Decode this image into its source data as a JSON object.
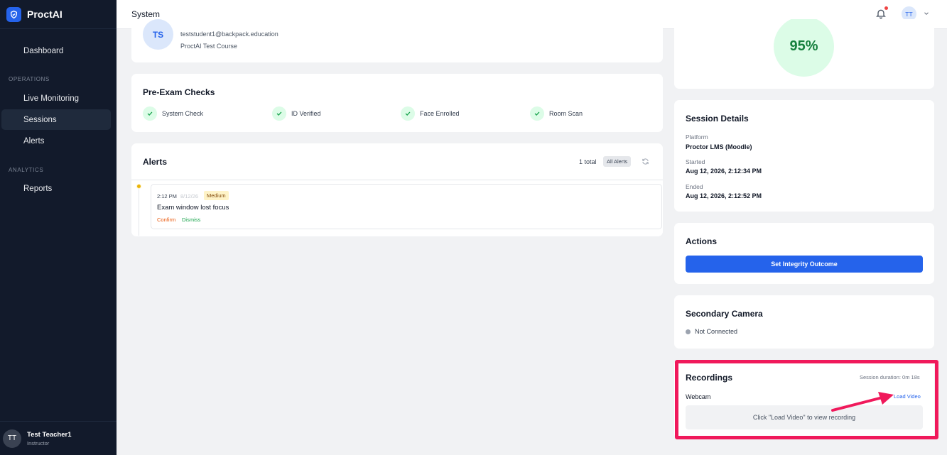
{
  "sidebar": {
    "brand": "ProctAI",
    "items": [
      {
        "label": "Dashboard"
      },
      {
        "label": "Live Monitoring"
      },
      {
        "label": "Sessions"
      },
      {
        "label": "Alerts"
      },
      {
        "label": "Reports"
      }
    ],
    "sections": [
      "OPERATIONS",
      "ANALYTICS"
    ],
    "active_item": "Sessions",
    "user": {
      "initials": "TT",
      "name": "Test Teacher1",
      "role": "Instructor"
    }
  },
  "topbar": {
    "title": "System",
    "avatar_initials": "TT",
    "notification_dot": true
  },
  "student": {
    "initials": "TS",
    "email": "teststudent1@backpack.education",
    "course": "ProctAI Test Course"
  },
  "score": {
    "value": "95%"
  },
  "pre_exam": {
    "title": "Pre-Exam Checks",
    "checks": [
      {
        "label": "System Check"
      },
      {
        "label": "ID Verified"
      },
      {
        "label": "Face Enrolled"
      },
      {
        "label": "Room Scan"
      }
    ]
  },
  "alerts": {
    "title": "Alerts",
    "total": "1 total",
    "filter": "All Alerts",
    "items": [
      {
        "time": "2:12 PM",
        "date": "8/12/26",
        "severity": "Medium",
        "message": "Exam window lost focus",
        "confirm": "Confirm",
        "dismiss": "Dismiss"
      }
    ]
  },
  "details": {
    "title": "Session Details",
    "platform_label": "Platform",
    "platform": "Proctor LMS (Moodle)",
    "started_label": "Started",
    "started": "Aug 12, 2026, 2:12:34 PM",
    "ended_label": "Ended",
    "ended": "Aug 12, 2026, 2:12:52 PM"
  },
  "actions": {
    "title": "Actions",
    "button": "Set Integrity Outcome"
  },
  "secondary_camera": {
    "title": "Secondary Camera",
    "status": "Not Connected"
  },
  "recordings": {
    "title": "Recordings",
    "duration": "Session duration: 0m 18s",
    "webcam": "Webcam",
    "load": "Load Video",
    "placeholder": "Click \"Load Video\" to view recording"
  },
  "colors": {
    "sidebar_bg": "#121a2b",
    "accent": "#2563eb",
    "highlight": "#f0195b",
    "success": "#15803d",
    "warning": "#eab308"
  }
}
